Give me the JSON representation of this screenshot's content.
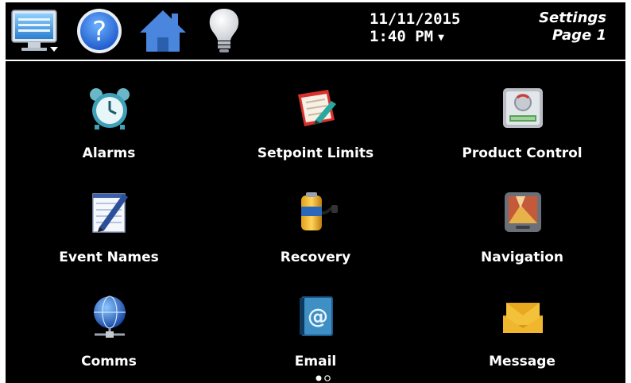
{
  "header": {
    "date": "11/11/2015",
    "time": "1:40 PM",
    "title_line1": "Settings",
    "title_line2": "Page 1",
    "icons": [
      "monitor-menu-icon",
      "help-icon",
      "home-icon",
      "lightbulb-icon"
    ]
  },
  "tiles": [
    {
      "label": "Alarms",
      "icon": "alarm-clock-icon"
    },
    {
      "label": "Setpoint Limits",
      "icon": "clipboard-pen-icon"
    },
    {
      "label": "Product Control",
      "icon": "control-panel-icon"
    },
    {
      "label": "Event Names",
      "icon": "notepad-pen-icon"
    },
    {
      "label": "Recovery",
      "icon": "battery-plug-icon"
    },
    {
      "label": "Navigation",
      "icon": "navigation-device-icon"
    },
    {
      "label": "Comms",
      "icon": "globe-network-icon"
    },
    {
      "label": "Email",
      "icon": "email-book-icon"
    },
    {
      "label": "Message",
      "icon": "envelope-icon"
    }
  ],
  "pagination": {
    "current": 1,
    "total": 2
  },
  "colors": {
    "background": "#000000",
    "text": "#ffffff",
    "help_blue": "#1f6fe0",
    "home_blue": "#3d7bd6"
  }
}
